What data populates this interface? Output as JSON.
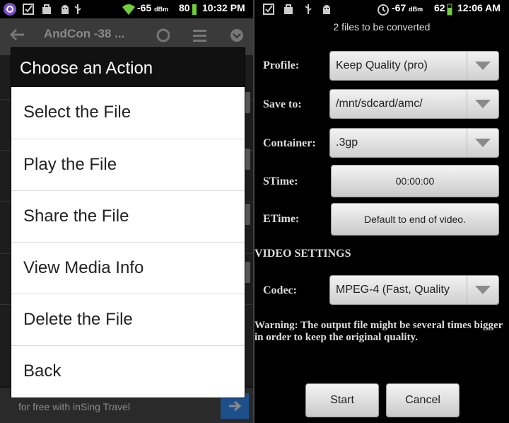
{
  "left_phone": {
    "status_bar": {
      "signal": "-65",
      "signal_unit": "dBm",
      "battery": "80",
      "time": "10:32 PM"
    },
    "background_app": {
      "title": "AndCon -38 ...",
      "ad_text": "for free with inSing Travel"
    },
    "dialog": {
      "title": "Choose an Action",
      "items": [
        {
          "label": "Select the File"
        },
        {
          "label": "Play the File"
        },
        {
          "label": "Share the File"
        },
        {
          "label": "View Media Info"
        },
        {
          "label": "Delete the File"
        },
        {
          "label": "Back"
        }
      ]
    }
  },
  "right_phone": {
    "status_bar": {
      "signal": "-67",
      "signal_unit": "dBm",
      "battery": "62",
      "time": "12:06 AM"
    },
    "files_info": "2  files to be converted",
    "form": {
      "profile": {
        "label": "Profile:",
        "value": "Keep Quality (pro)"
      },
      "save_to": {
        "label": "Save to:",
        "value": "/mnt/sdcard/amc/"
      },
      "container": {
        "label": "Container:",
        "value": ".3gp"
      },
      "stime": {
        "label": "STime:",
        "value": "00:00:00"
      },
      "etime": {
        "label": "ETime:",
        "value": "Default to end of video."
      },
      "video_settings_heading": "VIDEO SETTINGS",
      "codec": {
        "label": "Codec:",
        "value": "MPEG-4 (Fast, Quality"
      }
    },
    "warning": "Warning: The output file might be several times bigger in order to keep the original quality.",
    "buttons": {
      "start": "Start",
      "cancel": "Cancel"
    }
  },
  "colors": {
    "dialog_background": "#ffffff",
    "dialog_header": "#111111",
    "ad_button": "#1d4f8a",
    "button_gradient_top": "#f4f4f4",
    "button_gradient_bottom": "#c9c9c9"
  }
}
